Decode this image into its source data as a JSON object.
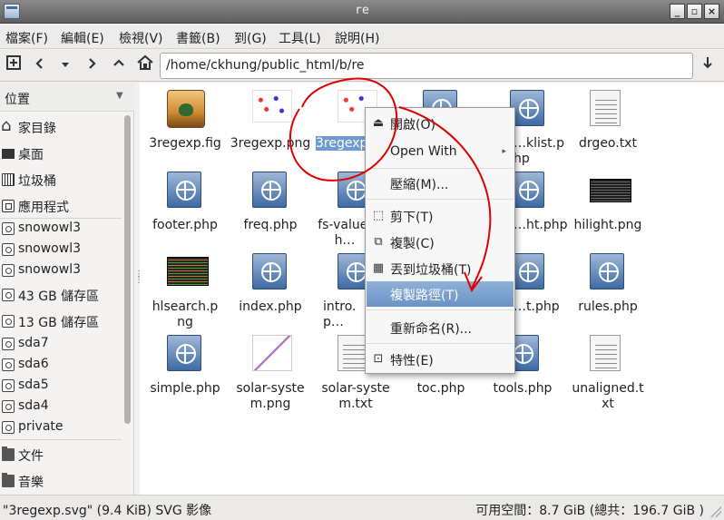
{
  "window": {
    "title": "re"
  },
  "menubar": [
    {
      "label": "檔案(F)"
    },
    {
      "label": "編輯(E)"
    },
    {
      "label": "檢視(V)"
    },
    {
      "label": "書籤(B)"
    },
    {
      "label": "到(G)"
    },
    {
      "label": "工具(L)"
    },
    {
      "label": "說明(H)"
    }
  ],
  "toolbar": {
    "path": "/home/ckhung/public_html/b/re",
    "icons": [
      "new-tab-icon",
      "back-icon",
      "history-dropdown-icon",
      "forward-icon",
      "up-icon",
      "home-icon",
      "go-icon"
    ]
  },
  "sidebar": {
    "header": "位置",
    "items": [
      {
        "label": "家目錄",
        "icon": "home-icon"
      },
      {
        "label": "桌面",
        "icon": "desktop-icon"
      },
      {
        "label": "垃圾桶",
        "icon": "trash-icon"
      },
      {
        "label": "應用程式",
        "icon": "applications-icon"
      },
      {
        "label": "snowowl3",
        "icon": "drive-icon"
      },
      {
        "label": "snowowl3",
        "icon": "drive-icon"
      },
      {
        "label": "snowowl3",
        "icon": "drive-icon"
      },
      {
        "label": "43 GB 儲存區",
        "icon": "drive-icon"
      },
      {
        "label": "13 GB 儲存區",
        "icon": "drive-icon"
      },
      {
        "label": "sda7",
        "icon": "drive-icon"
      },
      {
        "label": "sda6",
        "icon": "drive-icon"
      },
      {
        "label": "sda5",
        "icon": "drive-icon"
      },
      {
        "label": "sda4",
        "icon": "drive-icon"
      },
      {
        "label": "private",
        "icon": "drive-icon"
      },
      {
        "label": "文件",
        "icon": "folder-icon"
      },
      {
        "label": "音樂",
        "icon": "folder-icon"
      }
    ]
  },
  "files": [
    {
      "name": "3regexp.fig",
      "type": "fig"
    },
    {
      "name": "3regexp.png",
      "type": "thumb"
    },
    {
      "name": "3regexp.svg",
      "type": "thumb",
      "selected": true
    },
    {
      "name": "",
      "type": "php"
    },
    {
      "name": "…klist.php",
      "type": "php"
    },
    {
      "name": "drgeo.txt",
      "type": "txt"
    },
    {
      "name": "footer.php",
      "type": "php"
    },
    {
      "name": "freq.php",
      "type": "php"
    },
    {
      "name": "fs-value.h…",
      "type": "php"
    },
    {
      "name": "",
      "type": "none"
    },
    {
      "name": "…ht.php",
      "type": "php"
    },
    {
      "name": "hilight.png",
      "type": "dark"
    },
    {
      "name": "hlsearch.png",
      "type": "dark2"
    },
    {
      "name": "index.php",
      "type": "php"
    },
    {
      "name": "intro.p…",
      "type": "php"
    },
    {
      "name": "",
      "type": "none"
    },
    {
      "name": "…t.php",
      "type": "php"
    },
    {
      "name": "rules.php",
      "type": "php"
    },
    {
      "name": "simple.php",
      "type": "php"
    },
    {
      "name": "solar-system.png",
      "type": "chart"
    },
    {
      "name": "solar-system.txt",
      "type": "txt"
    },
    {
      "name": "toc.php",
      "type": "php"
    },
    {
      "name": "tools.php",
      "type": "php"
    },
    {
      "name": "unaligned.txt",
      "type": "txt"
    }
  ],
  "context_menu": {
    "items": [
      {
        "label": "開啟(O)",
        "icon": "open-icon"
      },
      {
        "label": "Open With",
        "submenu": true
      },
      {
        "label": "壓縮(M)..."
      },
      {
        "label": "剪下(T)",
        "icon": "cut-icon"
      },
      {
        "label": "複製(C)",
        "icon": "copy-icon"
      },
      {
        "label": "丟到垃圾桶(T)",
        "icon": "trash-icon"
      },
      {
        "label": "複製路徑(T)",
        "highlighted": true
      },
      {
        "label": "重新命名(R)..."
      },
      {
        "label": "特性(E)",
        "icon": "properties-icon"
      }
    ]
  },
  "statusbar": {
    "left": "\"3regexp.svg\" (9.4 KiB) SVG 影像",
    "right": "可用空間：8.7 GiB (總共：196.7 GiB )"
  },
  "colors": {
    "selection": "#6f9ccf",
    "annotation": "#e00000",
    "menu_highlight": "#7fa3cd"
  }
}
